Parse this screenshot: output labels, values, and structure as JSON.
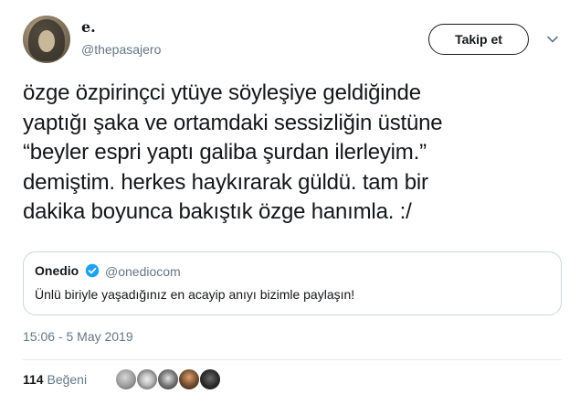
{
  "author": {
    "name": "e.",
    "handle": "@thepasajero"
  },
  "follow_button": {
    "label": "Takip et"
  },
  "tweet": {
    "lines": [
      "özge özpirinçci ytüye söyleşiye geldiğinde",
      "yaptığı şaka ve ortamdaki sessizliğin üstüne",
      "“beyler espri yaptı galiba şurdan ilerleyim.”",
      "demiştim. herkes haykırarak güldü. tam bir",
      "dakika boyunca bakıştık özge hanımla. :/"
    ]
  },
  "quoted_tweet": {
    "name": "Onedio",
    "handle": "@onediocom",
    "text": "Ünlü biriyle yaşadığınız en acayip anıyı bizimle paylaşın!",
    "verified_color": "#1da1f2"
  },
  "timestamp": "15:06 - 5 May 2019",
  "likes": {
    "count": "114",
    "label": "Beğeni"
  },
  "colors": {
    "text": "#14171a",
    "muted": "#657786",
    "border": "#ccd6dd"
  }
}
